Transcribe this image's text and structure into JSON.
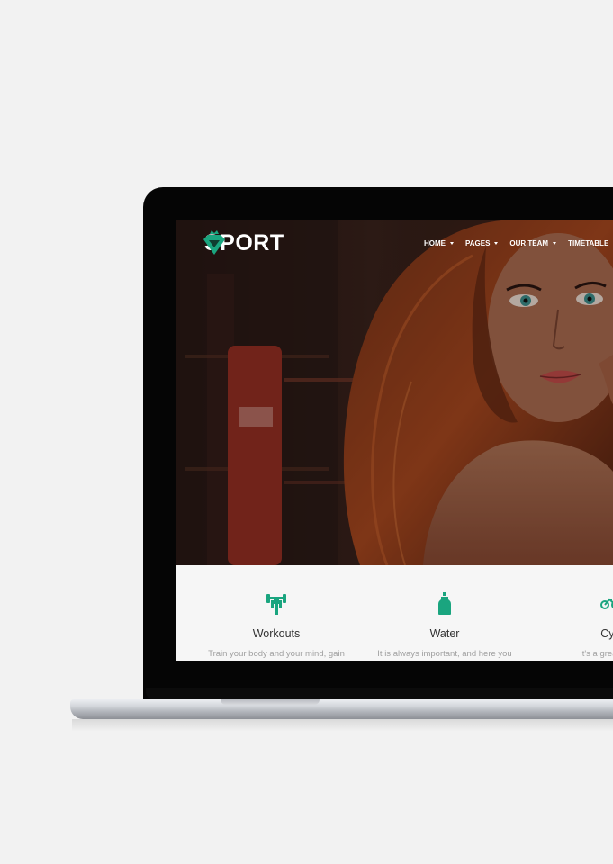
{
  "site": {
    "logo_text": "SPORT",
    "accent_color": "#1aa57f"
  },
  "nav": {
    "items": [
      {
        "label": "HOME",
        "has_dropdown": true
      },
      {
        "label": "PAGES",
        "has_dropdown": true
      },
      {
        "label": "OUR TEAM",
        "has_dropdown": true
      },
      {
        "label": "TIMETABLE",
        "has_dropdown": false
      }
    ]
  },
  "features": [
    {
      "icon": "dumbbell-icon",
      "title": "Workouts",
      "text": "Train your body and your mind, gain"
    },
    {
      "icon": "water-bottle-icon",
      "title": "Water",
      "text": "It is always important, and here you"
    },
    {
      "icon": "bicycle-icon",
      "title": "Cyc",
      "text": "It's a great sport"
    }
  ]
}
